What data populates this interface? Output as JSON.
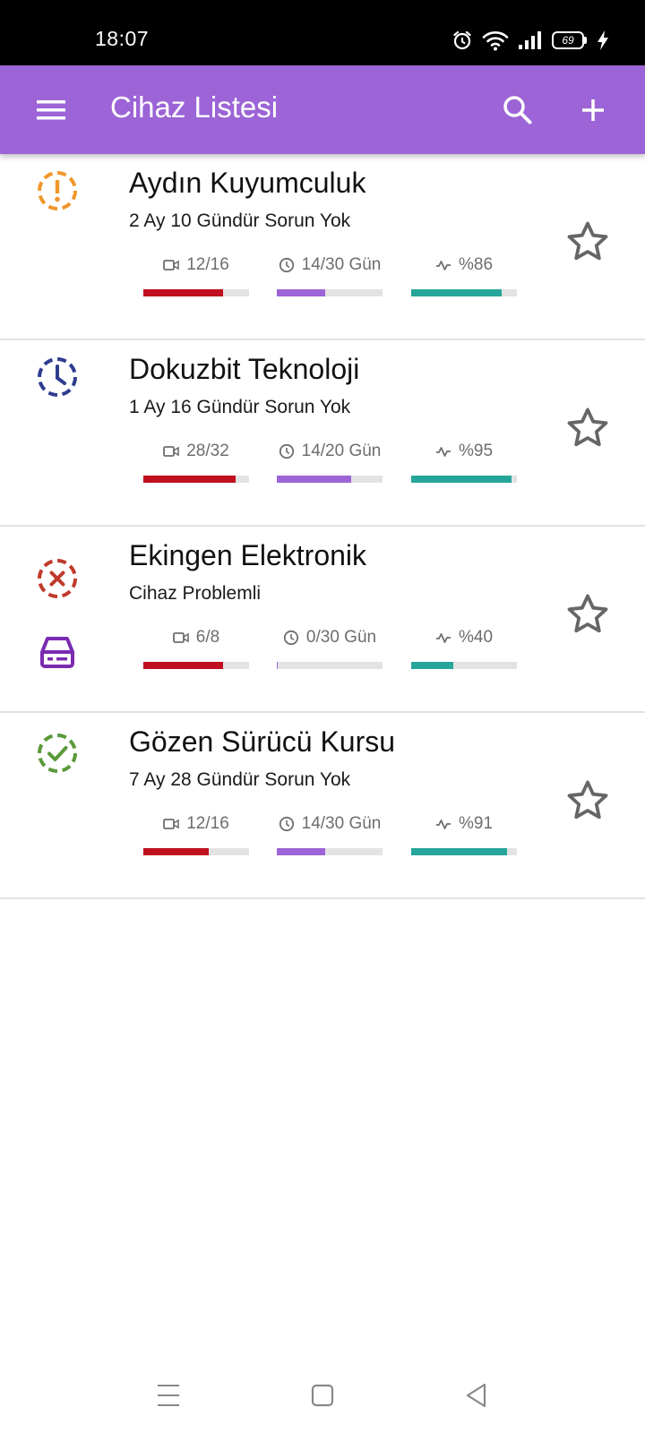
{
  "status_bar": {
    "time": "18:07",
    "battery_level": "69",
    "icons": [
      "alarm-icon",
      "wifi-icon",
      "signal-icon",
      "battery-icon",
      "charging-icon"
    ]
  },
  "app_bar": {
    "title": "Cihaz Listesi",
    "background": "#9c64d6",
    "icons": [
      "menu-icon",
      "search-icon",
      "add-icon"
    ]
  },
  "colors": {
    "camera_bar": "#c0101f",
    "days_bar": "#9c64d6",
    "health_bar": "#26a69a",
    "warning": "#f0962a",
    "pending": "#2f3c8f",
    "error": "#c0392b",
    "ok": "#5a9a3a",
    "storage": "#7a2bb0"
  },
  "devices": [
    {
      "name": "Aydın Kuyumculuk",
      "status_text": "2 Ay 10 Gündür Sorun Yok",
      "status_icon": "warning-circle-icon",
      "cameras": "12/16",
      "cameras_ratio": 0.75,
      "days": "14/30 Gün",
      "days_ratio": 0.46,
      "health": "%86",
      "health_ratio": 0.86,
      "storage_alert": false,
      "favorite": false
    },
    {
      "name": "Dokuzbit Teknoloji",
      "status_text": "1 Ay 16 Gündür Sorun Yok",
      "status_icon": "clock-circle-icon",
      "cameras": "28/32",
      "cameras_ratio": 0.875,
      "days": "14/20 Gün",
      "days_ratio": 0.7,
      "health": "%95",
      "health_ratio": 0.95,
      "storage_alert": false,
      "favorite": false
    },
    {
      "name": "Ekingen Elektronik",
      "status_text": "Cihaz Problemli",
      "status_icon": "error-circle-icon",
      "cameras": "6/8",
      "cameras_ratio": 0.75,
      "days": "0/30 Gün",
      "days_ratio": 0.01,
      "health": "%40",
      "health_ratio": 0.4,
      "storage_alert": true,
      "favorite": false
    },
    {
      "name": "Gözen Sürücü Kursu",
      "status_text": "7 Ay 28 Gündür Sorun Yok",
      "status_icon": "check-circle-icon",
      "cameras": "12/16",
      "cameras_ratio": 0.62,
      "days": "14/30 Gün",
      "days_ratio": 0.46,
      "health": "%91",
      "health_ratio": 0.91,
      "storage_alert": false,
      "favorite": false
    }
  ],
  "nav_bar": {
    "icons": [
      "recents-icon",
      "home-icon",
      "back-icon"
    ]
  }
}
